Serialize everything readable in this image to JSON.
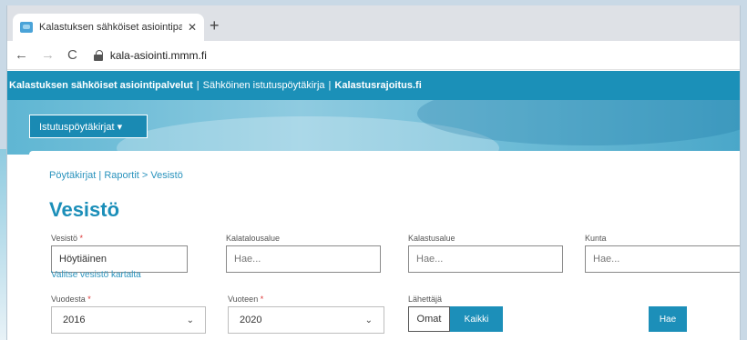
{
  "browser": {
    "tab_title": "Kalastuksen sähköiset asiointipal",
    "tab_close": "✕",
    "new_tab": "+",
    "url": "kala-asiointi.mmm.fi"
  },
  "site_header": {
    "part1": "Kalastuksen sähköiset asiointipalvelut",
    "sep1": "|",
    "part2": "Sähköinen istutuspöytäkirja",
    "sep2": "|",
    "part3": "Kalastusrajoitus.fi"
  },
  "banner": {
    "menu_label": "Istutuspöytäkirjat ▾"
  },
  "breadcrumb": "Pöytäkirjat | Raportit > Vesistö",
  "page_title": "Vesistö",
  "form": {
    "vesisto_label": "Vesistö",
    "vesisto_value": "Höytiäinen",
    "kalatalousalue_label": "Kalatalousalue",
    "kalatalousalue_placeholder": "Hae...",
    "kalastusalue_label": "Kalastusalue",
    "kalastusalue_placeholder": "Hae...",
    "kunta_label": "Kunta",
    "kunta_placeholder": "Hae...",
    "map_link": "Valitse vesistö kartalta",
    "vuodesta_label": "Vuodesta",
    "vuodesta_value": "2016",
    "vuoteen_label": "Vuoteen",
    "vuoteen_value": "2020",
    "lahettaja_label": "Lähettäjä",
    "omat_label": "Omat",
    "kaikki_label": "Kaikki",
    "hae_button": "Hae",
    "required_mark": "*"
  },
  "colors": {
    "brand": "#1c8fb9",
    "header": "#1b90b8"
  }
}
